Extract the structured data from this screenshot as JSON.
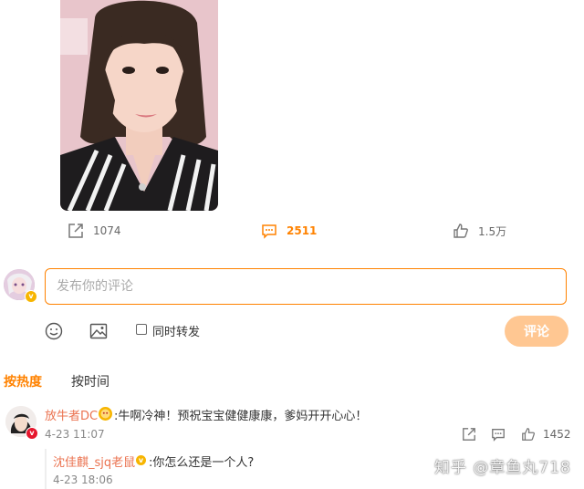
{
  "post": {
    "photo_alt": "photo",
    "actions": {
      "repost_count": "1074",
      "comment_count": "2511",
      "like_count": "1.5万"
    }
  },
  "composer": {
    "placeholder": "发布你的评论",
    "repost_label": "同时转发",
    "submit_label": "评论"
  },
  "sort": {
    "hot_label": "按热度",
    "time_label": "按时间"
  },
  "comments": [
    {
      "username": "放牛者DC",
      "text": ":牛啊冷神！预祝宝宝健健康康，爹妈开开心心！",
      "time": "4-23 11:07",
      "like_count": "1452",
      "reply": {
        "username": "沈佳麒_sjq老鼠",
        "text": ":你怎么还是一个人?",
        "time": "4-23 18:06"
      }
    }
  ],
  "watermark": "知乎 @章鱼丸718",
  "colors": {
    "accent": "#ff8200",
    "username": "#eb7350",
    "submit_disabled": "#ffc792"
  },
  "icons": [
    "repost-icon",
    "comment-icon",
    "like-icon",
    "emoji-icon",
    "image-icon",
    "verified-icon"
  ]
}
